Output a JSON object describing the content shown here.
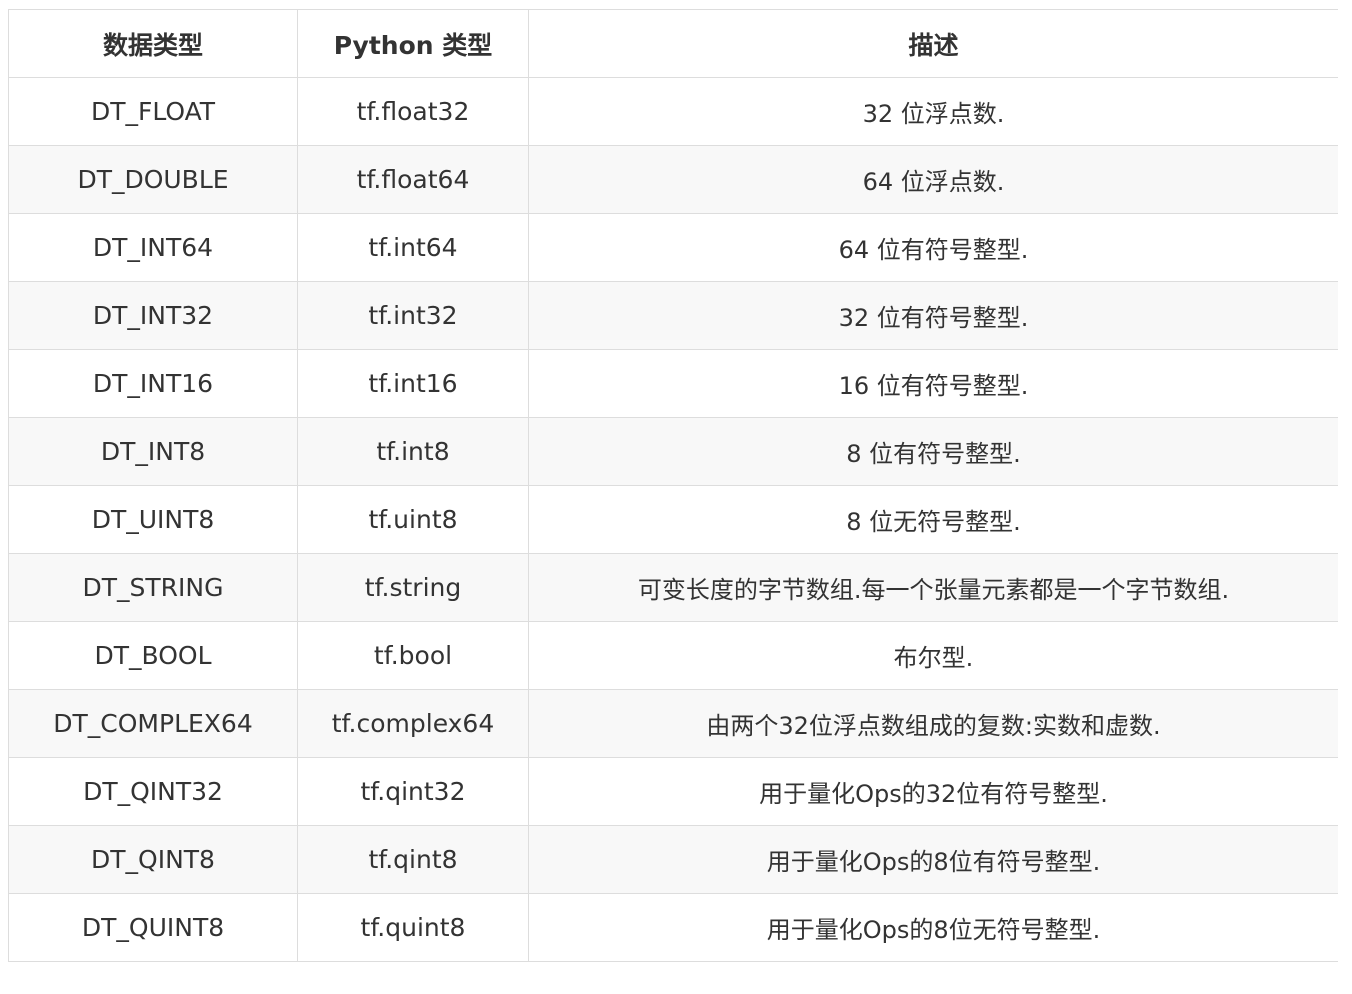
{
  "headers": [
    "数据类型",
    "Python 类型",
    "描述"
  ],
  "rows": [
    {
      "dtype": "DT_FLOAT",
      "python": "tf.float32",
      "desc": "32 位浮点数."
    },
    {
      "dtype": "DT_DOUBLE",
      "python": "tf.float64",
      "desc": "64 位浮点数."
    },
    {
      "dtype": "DT_INT64",
      "python": "tf.int64",
      "desc": "64 位有符号整型."
    },
    {
      "dtype": "DT_INT32",
      "python": "tf.int32",
      "desc": "32 位有符号整型."
    },
    {
      "dtype": "DT_INT16",
      "python": "tf.int16",
      "desc": "16 位有符号整型."
    },
    {
      "dtype": "DT_INT8",
      "python": "tf.int8",
      "desc": "8 位有符号整型."
    },
    {
      "dtype": "DT_UINT8",
      "python": "tf.uint8",
      "desc": "8 位无符号整型."
    },
    {
      "dtype": "DT_STRING",
      "python": "tf.string",
      "desc": "可变长度的字节数组.每一个张量元素都是一个字节数组."
    },
    {
      "dtype": "DT_BOOL",
      "python": "tf.bool",
      "desc": "布尔型."
    },
    {
      "dtype": "DT_COMPLEX64",
      "python": "tf.complex64",
      "desc": "由两个32位浮点数组成的复数:实数和虚数."
    },
    {
      "dtype": "DT_QINT32",
      "python": "tf.qint32",
      "desc": "用于量化Ops的32位有符号整型."
    },
    {
      "dtype": "DT_QINT8",
      "python": "tf.qint8",
      "desc": "用于量化Ops的8位有符号整型."
    },
    {
      "dtype": "DT_QUINT8",
      "python": "tf.quint8",
      "desc": "用于量化Ops的8位无符号整型."
    }
  ],
  "colors": {
    "border": "#dddddd",
    "stripe": "#f8f8f8",
    "text": "#333333"
  }
}
